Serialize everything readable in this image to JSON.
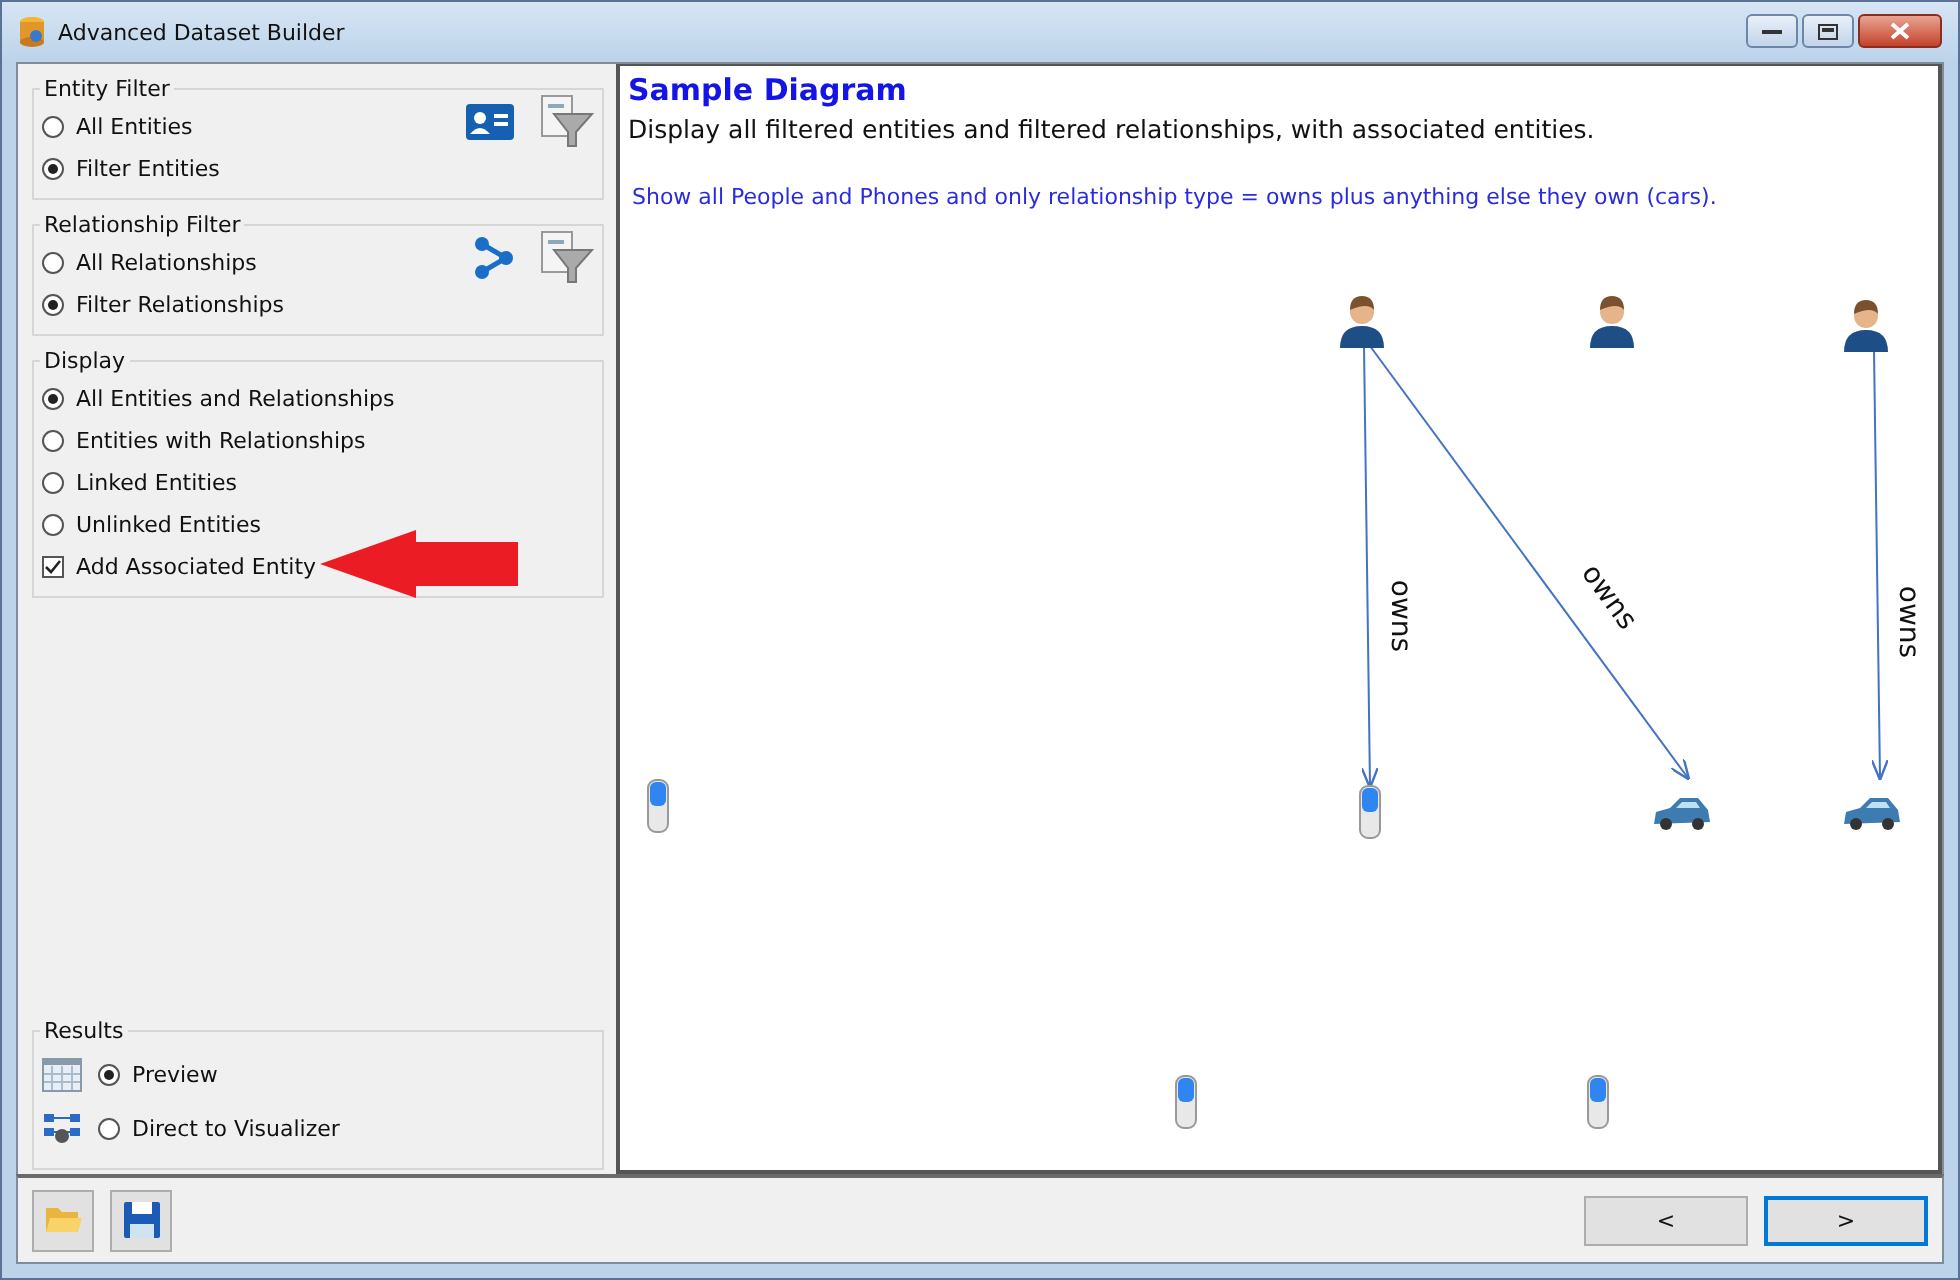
{
  "window": {
    "title": "Advanced Dataset Builder"
  },
  "filters": [
    {
      "title": "Entity Filter",
      "options": [
        {
          "kind": "radio",
          "label": "All Entities",
          "selected": false
        },
        {
          "kind": "radio",
          "label": "Filter Entities",
          "selected": true
        }
      ]
    },
    {
      "title": "Relationship Filter",
      "options": [
        {
          "kind": "radio",
          "label": "All Relationships",
          "selected": false
        },
        {
          "kind": "radio",
          "label": "Filter Relationships",
          "selected": true
        }
      ]
    },
    {
      "title": "Display",
      "options": [
        {
          "kind": "radio",
          "label": "All Entities and Relationships",
          "selected": true
        },
        {
          "kind": "radio",
          "label": "Entities with Relationships",
          "selected": false
        },
        {
          "kind": "radio",
          "label": "Linked Entities",
          "selected": false
        },
        {
          "kind": "radio",
          "label": "Unlinked Entities",
          "selected": false
        },
        {
          "kind": "checkbox",
          "label": "Add Associated Entity",
          "checked": true
        }
      ]
    }
  ],
  "results": {
    "title": "Results",
    "options": [
      {
        "label": "Preview",
        "selected": true
      },
      {
        "label": "Direct to Visualizer",
        "selected": false
      }
    ]
  },
  "diagram": {
    "title": "Sample Diagram",
    "description": "Display all filtered entities and filtered relationships, with associated entities.",
    "note": "Show all People and Phones and only relationship type = owns plus anything else they own (cars).",
    "nodes": [
      {
        "kind": "person"
      },
      {
        "kind": "person"
      },
      {
        "kind": "person"
      },
      {
        "kind": "phone"
      },
      {
        "kind": "phone"
      },
      {
        "kind": "car"
      },
      {
        "kind": "car"
      },
      {
        "kind": "phone"
      },
      {
        "kind": "phone"
      }
    ],
    "edges": [
      {
        "label": "owns"
      },
      {
        "label": "owns"
      },
      {
        "label": "owns"
      }
    ]
  },
  "nav_buttons": [
    {
      "label": "<",
      "focused": false
    },
    {
      "label": ">",
      "focused": true
    }
  ]
}
